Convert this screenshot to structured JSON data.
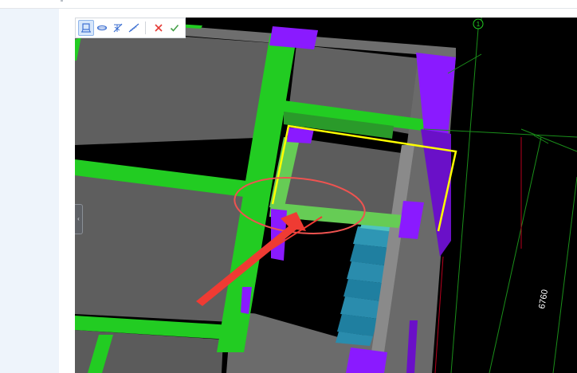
{
  "toolbar": {
    "tools": [
      {
        "icon": "stair-platform-icon",
        "active": true
      },
      {
        "icon": "slab-edge-icon",
        "active": false
      },
      {
        "icon": "stair-ramp-icon",
        "active": false
      },
      {
        "icon": "stair-steps-icon",
        "active": false
      }
    ],
    "cancel_icon": "close-icon",
    "confirm_icon": "check-icon",
    "colors": {
      "cancel": "#e53935",
      "confirm": "#43a047",
      "icon": "#3c6fd1"
    }
  },
  "viewport": {
    "axis_label": "1",
    "dimension_label": "6760",
    "colors": {
      "background": "#000000",
      "slab": "#666666",
      "beam": "#22cc22",
      "selected_beam": "#66cc55",
      "column": "#8a1aff",
      "stair": "#1f7fa0",
      "selection": "#ffff00",
      "highlight_circle": "#ef5350",
      "arrow": "#ef3b33",
      "grid_line": "#1a8f1a"
    }
  },
  "side_panel": {
    "collapse_icon": "chevron-left-icon"
  }
}
